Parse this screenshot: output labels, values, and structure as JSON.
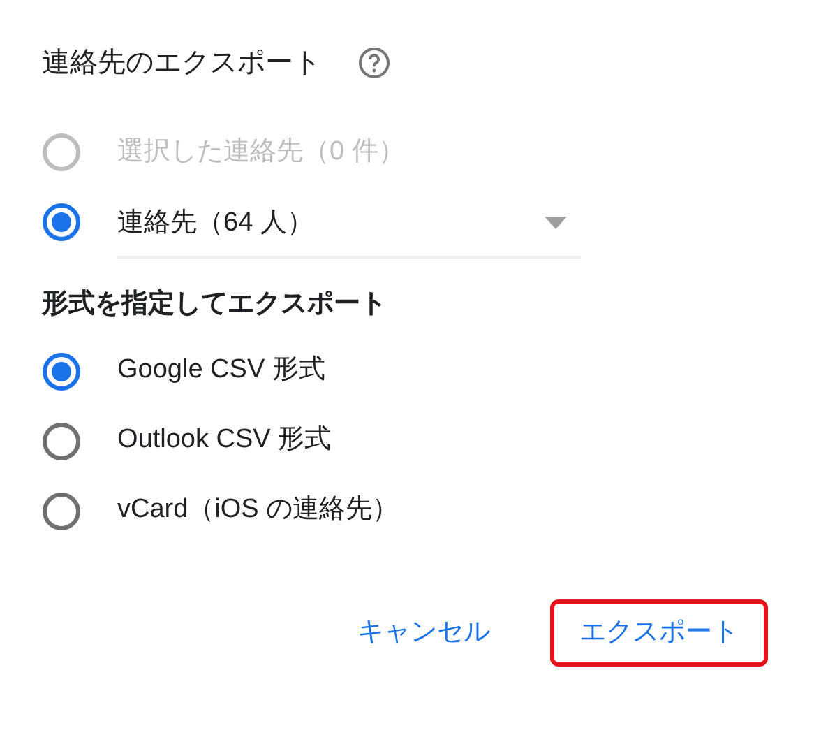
{
  "dialog": {
    "title": "連絡先のエクスポート",
    "help_icon": true
  },
  "scope_options": [
    {
      "label": "選択した連絡先（0 件）",
      "selected": false,
      "disabled": true,
      "kind": "plain"
    },
    {
      "label": "連絡先（64 人）",
      "selected": true,
      "disabled": false,
      "kind": "dropdown"
    }
  ],
  "format_heading": "形式を指定してエクスポート",
  "format_options": [
    {
      "label": "Google CSV 形式",
      "selected": true
    },
    {
      "label": "Outlook CSV 形式",
      "selected": false
    },
    {
      "label": "vCard（iOS の連絡先）",
      "selected": false
    }
  ],
  "buttons": [
    {
      "label": "キャンセル",
      "highlighted": false
    },
    {
      "label": "エクスポート",
      "highlighted": true
    }
  ]
}
